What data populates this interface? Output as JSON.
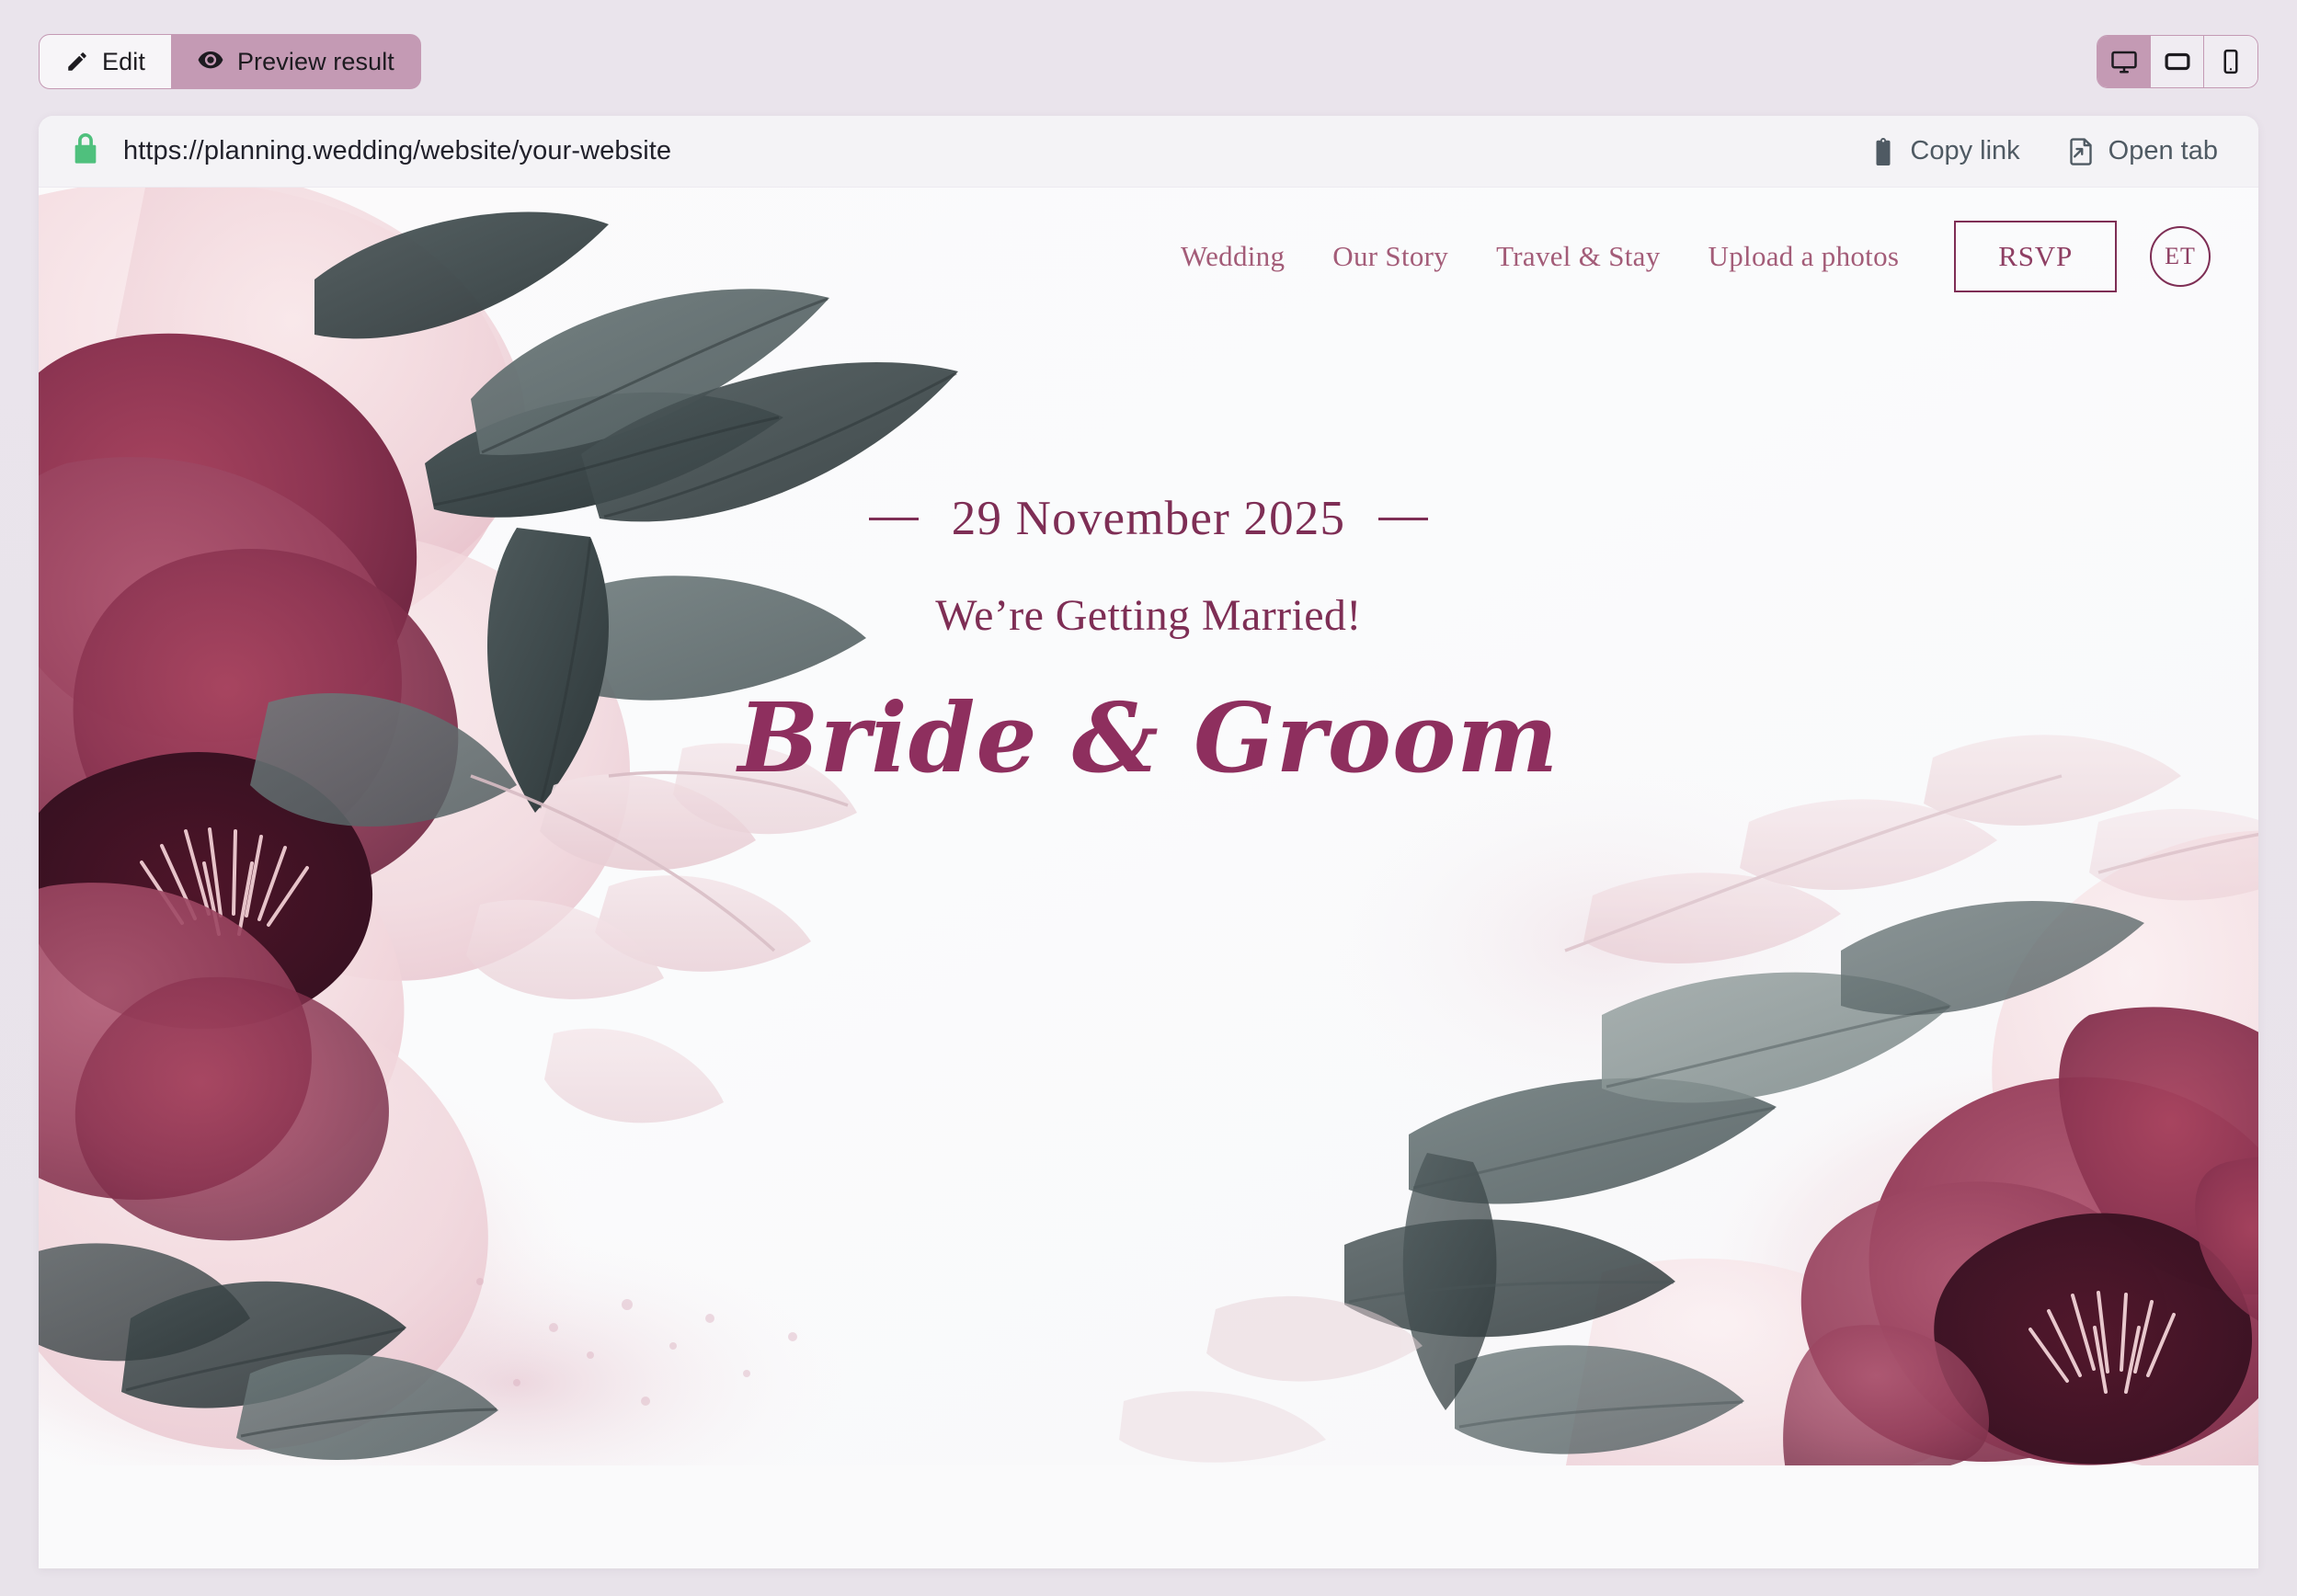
{
  "toolbar": {
    "mode_toggle": [
      {
        "label": "Edit",
        "icon": "pencil-icon",
        "active": false
      },
      {
        "label": "Preview result",
        "icon": "eye-icon",
        "active": true
      }
    ],
    "device_toggle": [
      {
        "name": "desktop",
        "icon": "desktop-icon",
        "active": true
      },
      {
        "name": "tablet",
        "icon": "tablet-icon",
        "active": false
      },
      {
        "name": "mobile",
        "icon": "mobile-icon",
        "active": false
      }
    ]
  },
  "browser": {
    "secure_icon": "lock-icon",
    "url": "https://planning.wedding/website/your-website",
    "actions": [
      {
        "label": "Copy link",
        "icon": "clipboard-icon"
      },
      {
        "label": "Open tab",
        "icon": "open-external-icon"
      }
    ]
  },
  "site": {
    "nav": [
      {
        "label": "Wedding"
      },
      {
        "label": "Our Story"
      },
      {
        "label": "Travel & Stay"
      },
      {
        "label": "Upload a photos"
      }
    ],
    "rsvp_label": "RSVP",
    "avatar_initials": "ET",
    "hero": {
      "date": "29 November 2025",
      "tagline": "We’re Getting Married!",
      "couple": "Bride & Groom"
    }
  },
  "colors": {
    "accent_wine": "#7e2e55",
    "accent_rose": "#a35c78",
    "toggle_pink": "#c49ab4",
    "lock_green": "#4fc07d",
    "toolbar_bg": "#eae4ec",
    "urlbar_bg": "#f4f3f6"
  }
}
